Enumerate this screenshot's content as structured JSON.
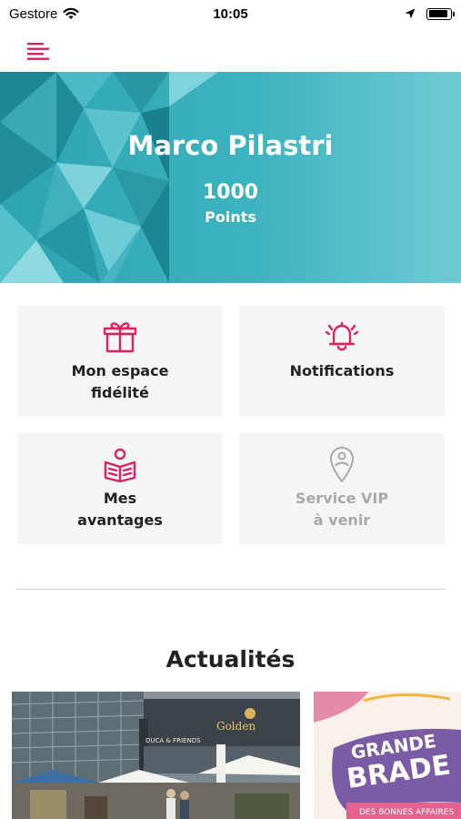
{
  "status_bar": {
    "carrier": "Gestore",
    "time": "10:05",
    "battery_level": 0.9
  },
  "nav": {
    "menu_icon": "menu-icon"
  },
  "profile": {
    "name": "Marco Pilastri",
    "points": "1000",
    "points_label": "Points"
  },
  "tiles": [
    {
      "line1": "Mon espace",
      "line2": "fidélité",
      "icon": "gift-icon",
      "enabled": true
    },
    {
      "line1": "Notifications",
      "line2": "",
      "icon": "bell-icon",
      "enabled": true
    },
    {
      "line1": "Mes",
      "line2": "avantages",
      "icon": "reader-icon",
      "enabled": true
    },
    {
      "line1": "Service VIP",
      "line2": "à venir",
      "icon": "location-pin-icon",
      "enabled": false
    }
  ],
  "news": {
    "title": "Actualités",
    "cards": [
      {
        "signs": [
          "DUCA & FRIENDS",
          "Golden"
        ],
        "image": "shopping-center-terrace-photo"
      },
      {
        "headline_line1": "GRANDE",
        "headline_line2": "BRADE",
        "tagline": "DES BONNES AFFAIRES",
        "image": "grande-braderie-poster"
      }
    ]
  },
  "colors": {
    "accent": "#d9245f",
    "hero": "#3db3bf",
    "tile_bg": "#f5f5f5",
    "disabled": "#a8a8a8"
  }
}
